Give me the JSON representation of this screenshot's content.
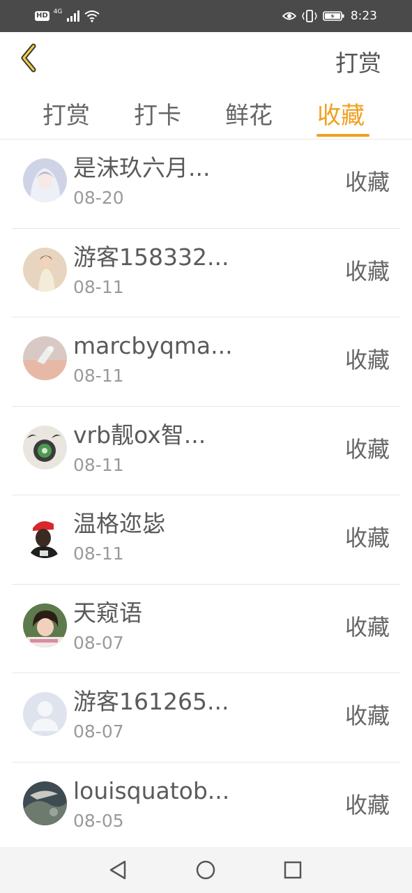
{
  "status_bar": {
    "hd_label": "HD",
    "network_label": "4G",
    "time": "8:23"
  },
  "header": {
    "back_icon": "chevron-left-icon",
    "action_label": "打赏"
  },
  "tabs": [
    {
      "label": "打赏",
      "active": false
    },
    {
      "label": "打卡",
      "active": false
    },
    {
      "label": "鲜花",
      "active": false
    },
    {
      "label": "收藏",
      "active": true
    }
  ],
  "accent_color": "#f0a020",
  "list": [
    {
      "name": "是沫玖六月...",
      "date": "08-20",
      "type": "收藏"
    },
    {
      "name": "游客158332...",
      "date": "08-11",
      "type": "收藏"
    },
    {
      "name": "marcbyqma...",
      "date": "08-11",
      "type": "收藏"
    },
    {
      "name": "vrb靓ox智...",
      "date": "08-11",
      "type": "收藏"
    },
    {
      "name": "温格迩毖",
      "date": "08-11",
      "type": "收藏"
    },
    {
      "name": "天窥语",
      "date": "08-07",
      "type": "收藏"
    },
    {
      "name": "游客161265...",
      "date": "08-07",
      "type": "收藏"
    },
    {
      "name": "louisquatob...",
      "date": "08-05",
      "type": "收藏"
    }
  ]
}
